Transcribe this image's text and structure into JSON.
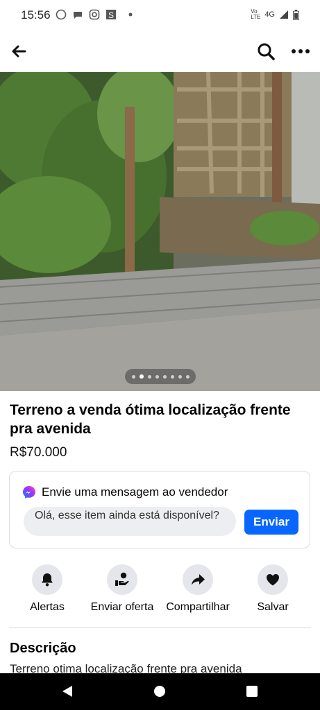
{
  "status_bar": {
    "time": "15:56",
    "network": "4G"
  },
  "listing": {
    "title": " Terreno a venda ótima localização frente pra avenida",
    "price": "R$70.000",
    "photo_count": 8,
    "photo_index": 2
  },
  "message": {
    "header": "Envie uma mensagem ao vendedor",
    "text": "Olá, esse item ainda está disponível?",
    "send_label": "Enviar"
  },
  "actions": [
    {
      "label": "Alertas",
      "icon": "bell-icon"
    },
    {
      "label": "Enviar oferta",
      "icon": "offer-icon"
    },
    {
      "label": "Compartilhar",
      "icon": "share-icon"
    },
    {
      "label": "Salvar",
      "icon": "heart-icon"
    }
  ],
  "description": {
    "heading": "Descrição",
    "text": "Terreno otima localização frente pra avenida"
  },
  "colors": {
    "accent": "#0866ff",
    "action_bg": "#e4e6eb"
  }
}
